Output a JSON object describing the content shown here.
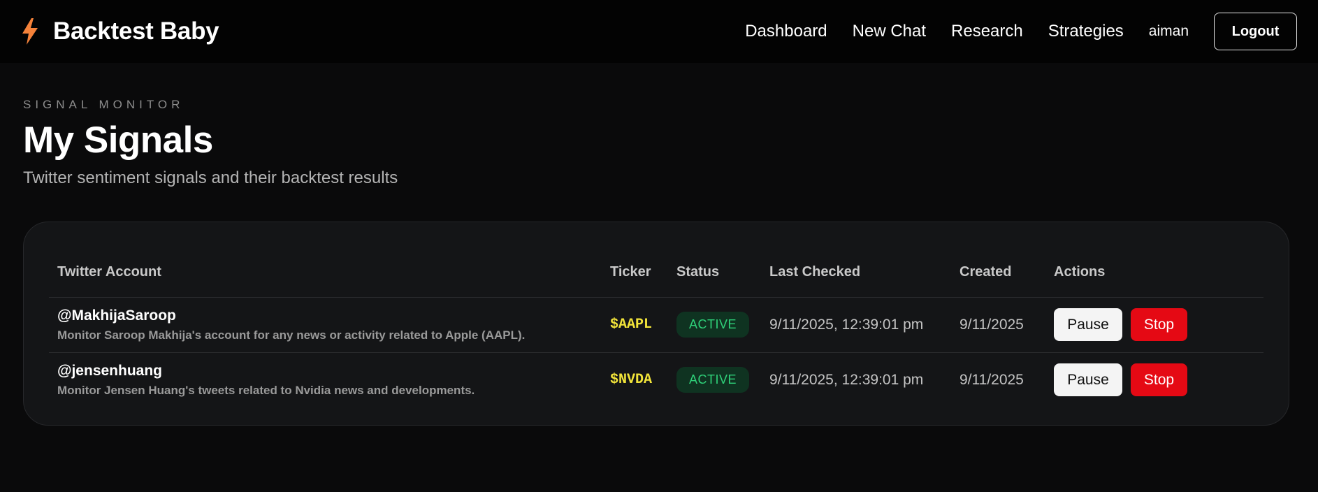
{
  "app": {
    "name": "Backtest Baby",
    "logo_icon": "lightning-bolt-icon",
    "accent": "#f5823a"
  },
  "nav": {
    "links": [
      "Dashboard",
      "New Chat",
      "Research",
      "Strategies"
    ],
    "user": "aiman",
    "logout_label": "Logout"
  },
  "header": {
    "eyebrow": "SIGNAL MONITOR",
    "title": "My Signals",
    "subtitle": "Twitter sentiment signals and their backtest results"
  },
  "table": {
    "columns": [
      "Twitter Account",
      "Ticker",
      "Status",
      "Last Checked",
      "Created",
      "Actions"
    ],
    "rows": [
      {
        "handle": "@MakhijaSaroop",
        "description": "Monitor Saroop Makhija's account for any news or activity related to Apple (AAPL).",
        "ticker": "$AAPL",
        "status": "ACTIVE",
        "last_checked": "9/11/2025, 12:39:01 pm",
        "created": "9/11/2025",
        "pause_label": "Pause",
        "stop_label": "Stop"
      },
      {
        "handle": "@jensenhuang",
        "description": "Monitor Jensen Huang's tweets related to Nvidia news and developments.",
        "ticker": "$NVDA",
        "status": "ACTIVE",
        "last_checked": "9/11/2025, 12:39:01 pm",
        "created": "9/11/2025",
        "pause_label": "Pause",
        "stop_label": "Stop"
      }
    ]
  },
  "colors": {
    "ticker": "#f2e43a",
    "status_active_text": "#2fd27a",
    "status_active_bg": "#0f3321",
    "stop_button": "#e50914"
  }
}
